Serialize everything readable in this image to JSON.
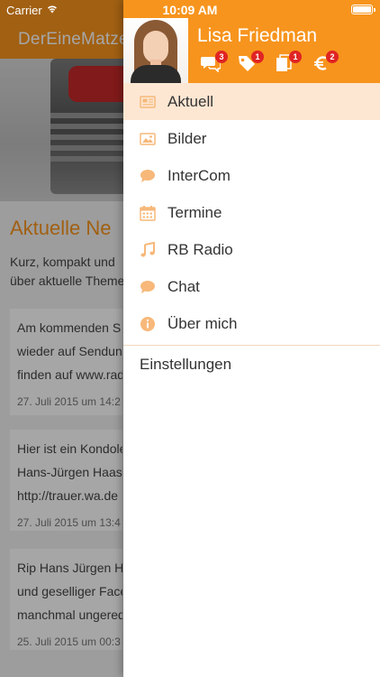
{
  "status_bar": {
    "carrier": "Carrier",
    "time": "10:09 AM"
  },
  "background": {
    "nav_title": "DerEineMatze",
    "section_title": "Aktuelle Ne",
    "intro_lines": [
      "Kurz, kompakt und",
      "über aktuelle Theme"
    ],
    "cards": [
      {
        "lines": [
          "Am kommenden S",
          "wieder auf Sendun",
          "finden auf www.rad"
        ],
        "date": "27. Juli 2015 um 14:2"
      },
      {
        "lines": [
          "Hier ist ein Kondole",
          "Hans-Jürgen Haas",
          "http://trauer.wa.de"
        ],
        "date": "27. Juli 2015 um 13:4"
      },
      {
        "lines": [
          "Rip Hans Jürgen H",
          "und geselliger Face",
          "manchmal ungered"
        ],
        "date": "25. Juli 2015 um 00:3"
      }
    ]
  },
  "drawer": {
    "user_name": "Lisa Friedman",
    "header_icons": [
      {
        "icon": "chat-bubbles-icon",
        "badge": "3"
      },
      {
        "icon": "tag-icon",
        "badge": "1"
      },
      {
        "icon": "documents-icon",
        "badge": "1"
      },
      {
        "icon": "euro-icon",
        "badge": "2"
      }
    ],
    "menu": [
      {
        "label": "Aktuell",
        "icon": "newspaper-icon",
        "active": true
      },
      {
        "label": "Bilder",
        "icon": "image-icon"
      },
      {
        "label": "InterCom",
        "icon": "speech-bubble-icon"
      },
      {
        "label": "Termine",
        "icon": "calendar-icon"
      },
      {
        "label": "RB Radio",
        "icon": "music-note-icon"
      },
      {
        "label": "Chat",
        "icon": "chat-icon"
      },
      {
        "label": "Über mich",
        "icon": "info-icon"
      }
    ],
    "settings_label": "Einstellungen"
  },
  "colors": {
    "accent": "#f7941d",
    "active_row": "#fde7d3",
    "badge": "#e02424"
  }
}
